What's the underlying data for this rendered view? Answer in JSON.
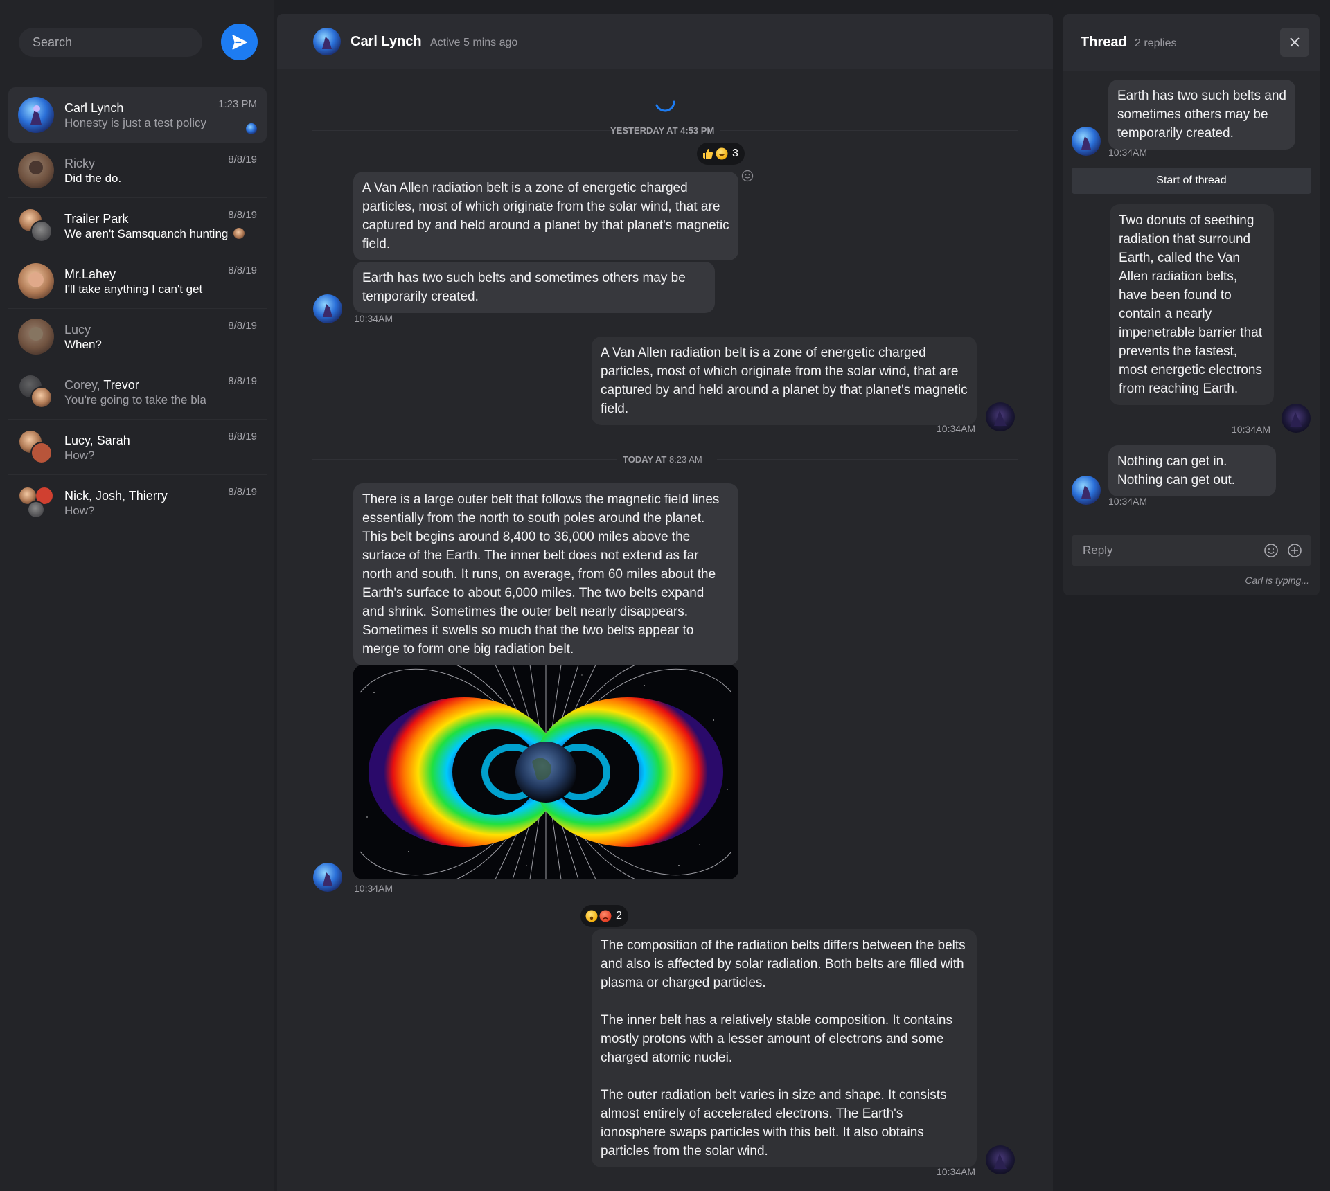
{
  "sidebar": {
    "search_placeholder": "Search",
    "conversations": [
      {
        "name": "Carl Lynch",
        "preview": "Honesty is just a test policy",
        "time": "1:23 PM"
      },
      {
        "name": "Ricky",
        "preview": "Did the do.",
        "time": "8/8/19"
      },
      {
        "name": "Trailer Park",
        "preview": "We aren't Samsquanch hunting",
        "time": "8/8/19"
      },
      {
        "name": "Mr.Lahey",
        "preview": "I'll take anything I can't get",
        "time": "8/8/19"
      },
      {
        "name": "Lucy",
        "preview": "When?",
        "time": "8/8/19"
      },
      {
        "name_dim": "Corey,",
        "name_bold": "Trevor",
        "preview": "You're going to take the bla",
        "time": "8/8/19"
      },
      {
        "name": "Lucy, Sarah",
        "preview": "How?",
        "time": "8/8/19"
      },
      {
        "name": "Nick, Josh, Thierry",
        "preview": "How?",
        "time": "8/8/19"
      }
    ]
  },
  "chat": {
    "contact_name": "Carl Lynch",
    "status": "Active 5 mins ago",
    "separators": [
      {
        "bold": "YESTERDAY AT 4:53 PM",
        "rest": ""
      },
      {
        "bold": "TODAY AT",
        "rest": " 8:23 AM"
      }
    ],
    "messages": {
      "m1": "A Van Allen radiation belt is a zone of energetic charged particles, most of which originate from the solar wind, that are captured by and held around a planet by that planet's magnetic field.",
      "m2": "Earth has two such belts and sometimes others may be temporarily created.",
      "m3": "A Van Allen radiation belt is a zone of energetic charged particles, most of which originate from the solar wind, that are captured by and held around a planet by that planet's magnetic field.",
      "m4": "There is a large outer belt that follows the magnetic field lines essentially from the north to south poles around the planet. This belt begins around 8,400 to 36,000 miles above the surface of the Earth. The inner belt does not extend as far north and south. It runs, on average, from 60 miles about the Earth's surface to about 6,000 miles. The two belts expand and shrink. Sometimes the outer belt nearly disappears. Sometimes it swells so much that the two belts appear to merge to form one big radiation belt.",
      "m5_p1": "The composition of the radiation belts differs between the belts and also is affected by solar radiation. Both belts are filled with plasma or charged particles.",
      "m5_p2": "The inner belt has a relatively stable composition. It contains mostly protons with a lesser amount of electrons and some charged atomic nuclei.",
      "m5_p3": "The outer radiation belt varies in size and shape. It consists almost entirely of accelerated electrons. The Earth's ionosphere swaps particles with this belt. It also obtains particles from the solar wind."
    },
    "timestamps": {
      "t1": "10:34AM",
      "t2": "10:34AM",
      "t3": "10:34AM",
      "t4": "10:34AM"
    },
    "reactions": {
      "r1_count": "3",
      "r2_count": "2"
    }
  },
  "thread": {
    "title": "Thread",
    "reply_count": "2 replies",
    "msg1": "Earth has two such belts and sometimes others may be temporarily created.",
    "ts1": "10:34AM",
    "start_label": "Start of thread",
    "msg2": "Two donuts of seething radiation that surround Earth, called the Van Allen radiation belts, have been found to contain a nearly impenetrable barrier that prevents the fastest, most energetic electrons from reaching Earth.",
    "ts2": "10:34AM",
    "msg3_l1": "Nothing can get in.",
    "msg3_l2": "Nothing can get out.",
    "ts3": "10:34AM",
    "reply_placeholder": "Reply",
    "typing": "Carl is typing..."
  },
  "colors": {
    "accent": "#1d7cf2",
    "background": "#1f2024",
    "bubble": "#37383d"
  }
}
